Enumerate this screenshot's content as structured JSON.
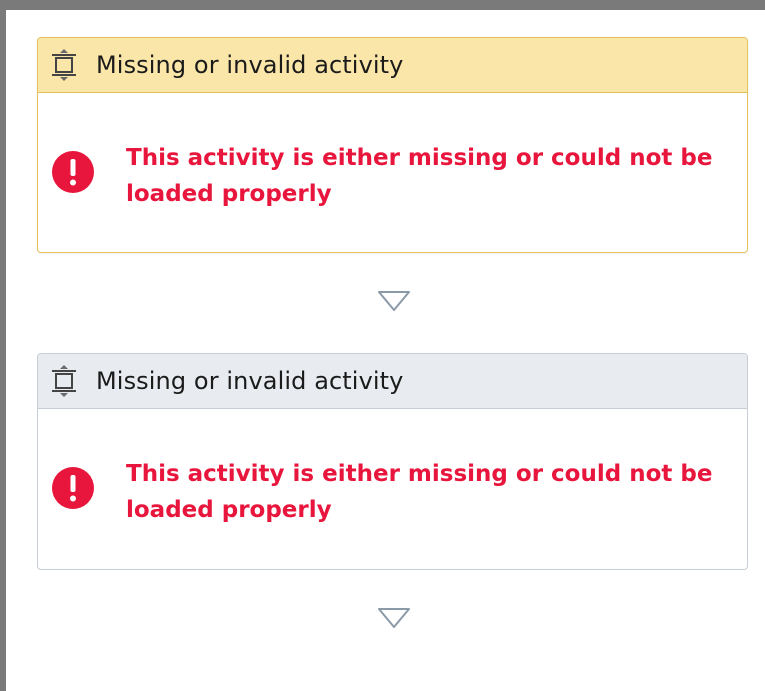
{
  "colors": {
    "selected_header_bg": "#fbe6a9",
    "selected_border": "#e6c25b",
    "normal_header_bg": "#e8ebef",
    "normal_border": "#c7ced6",
    "error_red": "#e8163c",
    "frame_border": "#7a7a7a"
  },
  "activities": [
    {
      "state": "selected",
      "icon": "activity-icon",
      "title": "Missing or invalid activity",
      "error_icon": "error-circle-icon",
      "error_message": "This activity is either missing or could not be loaded properly"
    },
    {
      "state": "normal",
      "icon": "activity-icon",
      "title": "Missing or invalid activity",
      "error_icon": "error-circle-icon",
      "error_message": "This activity is either missing or could not be loaded properly"
    }
  ],
  "connectors": [
    {
      "icon": "down-triangle-icon"
    },
    {
      "icon": "down-triangle-icon"
    }
  ]
}
